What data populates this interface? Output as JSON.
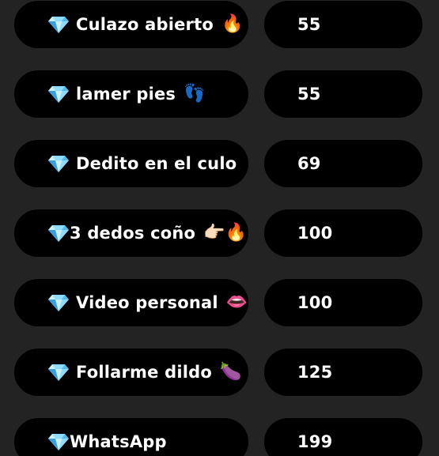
{
  "items": [
    {
      "name": "Culazo abierto",
      "emoji": "🔥",
      "price": "55",
      "gap": true
    },
    {
      "name": "lamer pies",
      "emoji": "👣",
      "price": "55",
      "gap": true
    },
    {
      "name": "Dedito en el culo",
      "emoji": "",
      "price": "69",
      "gap": true
    },
    {
      "name": "3 dedos coño",
      "emoji": "👉🏻🔥",
      "price": "100",
      "gap": false
    },
    {
      "name": "Video personal",
      "emoji": "👄",
      "price": "100",
      "gap": true
    },
    {
      "name": "Follarme dildo",
      "emoji": "🍆",
      "price": "125",
      "gap": true
    },
    {
      "name": "WhatsApp",
      "emoji": "",
      "price": "199",
      "gap": false
    }
  ],
  "icons": {
    "item_icon": "gem-icon"
  },
  "colors": {
    "background": "#232323",
    "pill": "#000000",
    "text": "#ffffff",
    "gem": "#8fdcff"
  }
}
